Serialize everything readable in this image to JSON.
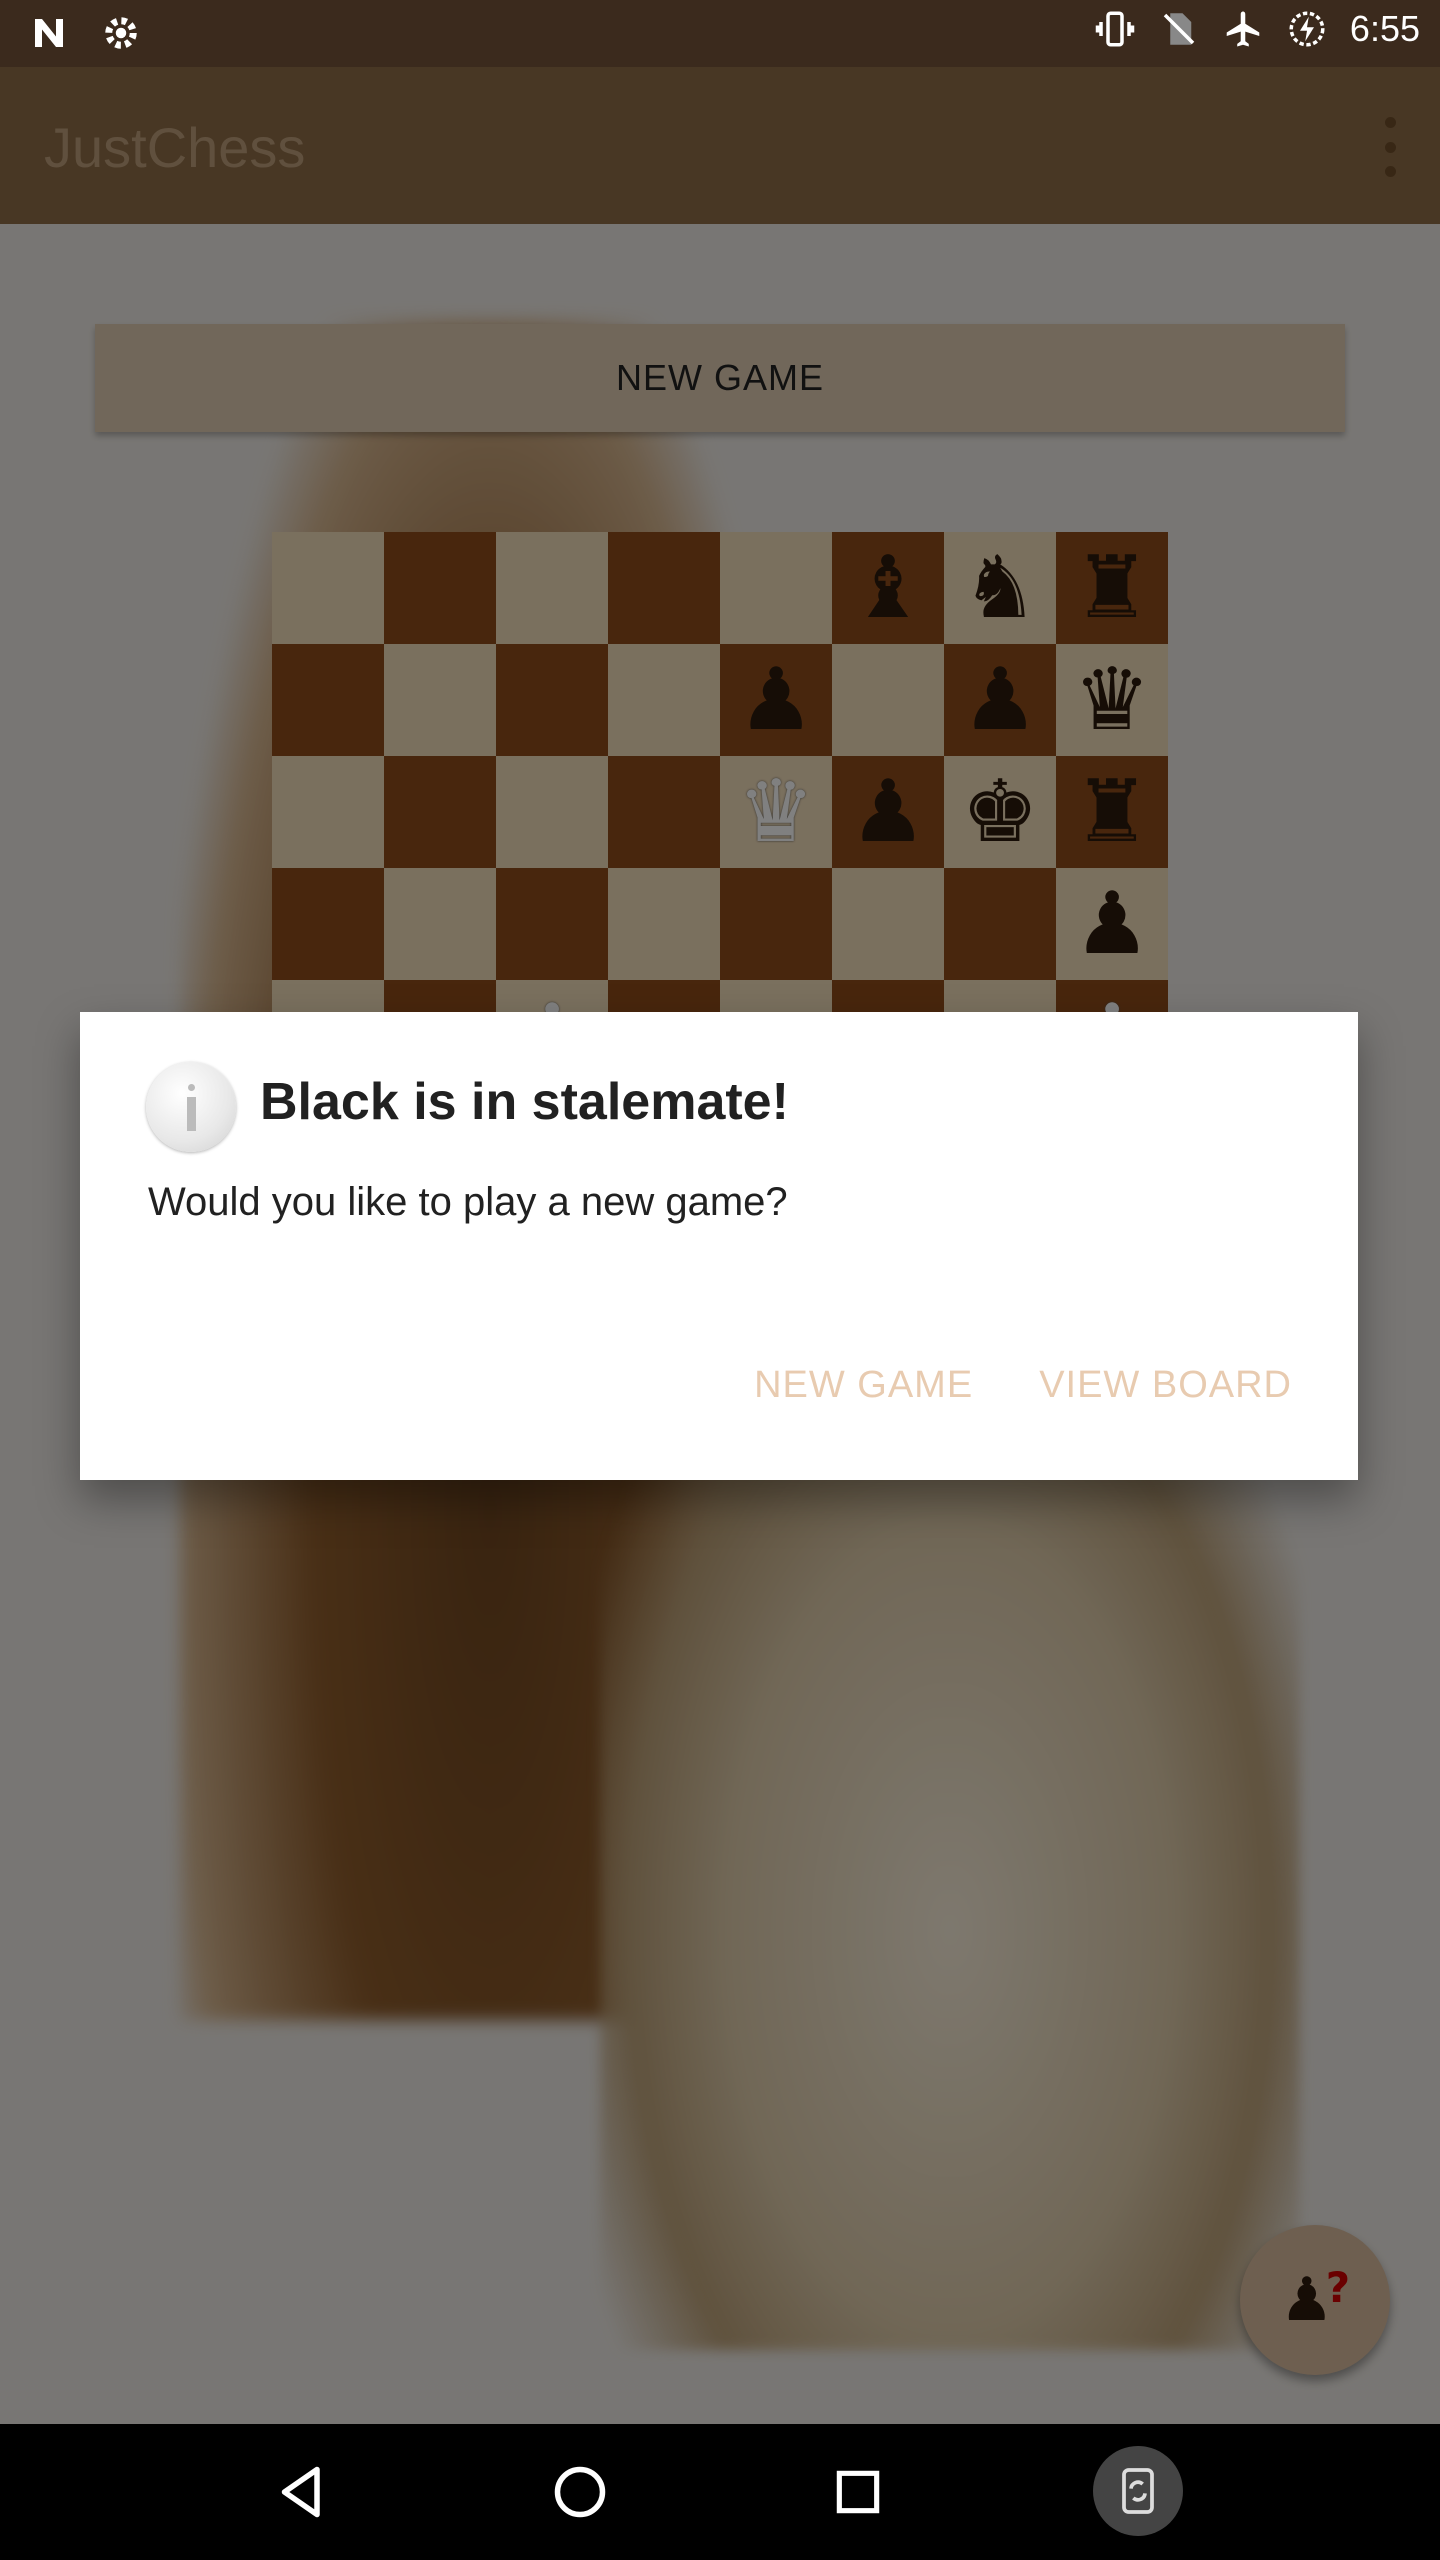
{
  "status_bar": {
    "time": "6:55",
    "left_icons": [
      "notification-n-icon",
      "settings-gear-icon"
    ],
    "right_icons": [
      "vibrate-icon",
      "no-sim-icon",
      "airplane-mode-icon",
      "battery-charging-icon"
    ]
  },
  "app_bar": {
    "title": "JustChess",
    "overflow_icon": "more-vert-icon"
  },
  "main": {
    "new_game_label": "NEW GAME"
  },
  "board": {
    "visible_rows": [
      [
        "",
        "",
        "",
        "",
        "",
        "b-bishop",
        "b-knight",
        "b-rook"
      ],
      [
        "",
        "",
        "",
        "",
        "b-pawn",
        "",
        "b-pawn",
        "b-queen"
      ],
      [
        "",
        "",
        "",
        "",
        "w-queen",
        "b-pawn",
        "b-king",
        "b-rook"
      ],
      [
        "",
        "",
        "",
        "",
        "",
        "",
        "",
        "b-pawn"
      ],
      [
        "",
        "",
        "w-pawn",
        "",
        "",
        "",
        "",
        "w-pawn"
      ]
    ]
  },
  "dialog": {
    "icon": "info-icon",
    "title": "Black is in stalemate!",
    "message": "Would you like to play a new game?",
    "button_new_game": "NEW GAME",
    "button_view_board": "VIEW BOARD"
  },
  "fab": {
    "icon": "chess-pawn-question-icon",
    "badge": "?"
  },
  "nav_bar": {
    "icons": [
      "back-icon",
      "home-icon",
      "recents-icon",
      "rotate-icon"
    ]
  },
  "colors": {
    "status_bar": "#3b2a1d",
    "app_bar": "#8a6a45",
    "accent": "#e8cbb0",
    "board_light": "#ead6b4",
    "board_dark": "#8a4a1a"
  }
}
